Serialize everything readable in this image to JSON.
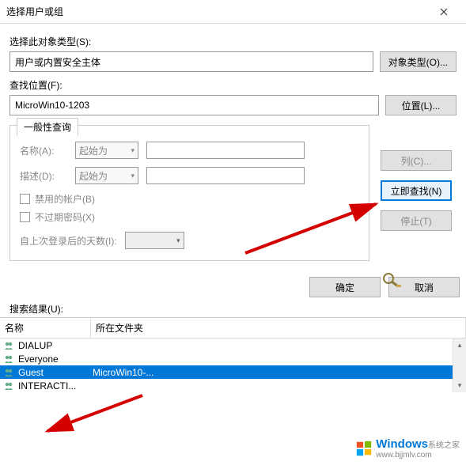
{
  "titlebar": {
    "title": "选择用户或组"
  },
  "object_type": {
    "label": "选择此对象类型(S):",
    "value": "用户或内置安全主体",
    "button": "对象类型(O)..."
  },
  "location": {
    "label": "查找位置(F):",
    "value": "MicroWin10-1203",
    "button": "位置(L)..."
  },
  "query": {
    "tab_label": "一般性查询",
    "name_label": "名称(A):",
    "name_mode": "起始为",
    "desc_label": "描述(D):",
    "desc_mode": "起始为",
    "disabled_label": "禁用的帐户(B)",
    "noexpire_label": "不过期密码(X)",
    "days_label": "自上次登录后的天数(I):"
  },
  "side_buttons": {
    "columns": "列(C)...",
    "find_now": "立即查找(N)",
    "stop": "停止(T)"
  },
  "actions": {
    "ok": "确定",
    "cancel": "取消"
  },
  "results": {
    "label": "搜索结果(U):",
    "col_name": "名称",
    "col_folder": "所在文件夹",
    "rows": [
      {
        "name": "DIALUP",
        "folder": ""
      },
      {
        "name": "Everyone",
        "folder": ""
      },
      {
        "name": "Guest",
        "folder": "MicroWin10-..."
      },
      {
        "name": "INTERACTI...",
        "folder": ""
      }
    ],
    "selected_index": 2
  },
  "watermark": {
    "main": "Windows",
    "sub1": "系统之家",
    "sub2": "www.bjjmlv.com"
  }
}
